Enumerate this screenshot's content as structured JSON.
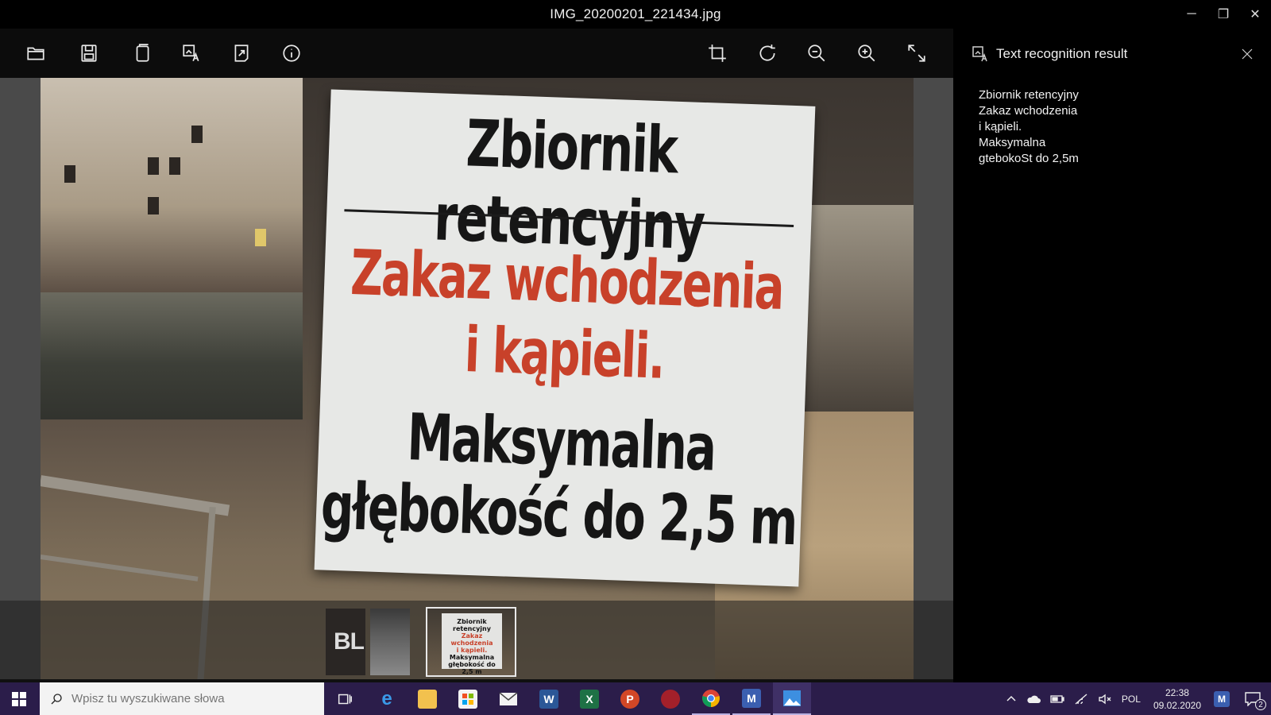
{
  "window": {
    "title": "IMG_20200201_221434.jpg",
    "controls": {
      "minimize": "─",
      "restore": "❐",
      "close": "✕"
    }
  },
  "toolbar": {
    "left_icons": [
      "folder-open-icon",
      "save-icon",
      "copy-icon",
      "text-recognition-icon",
      "export-icon",
      "info-icon"
    ],
    "right_icons": [
      "crop-icon",
      "rotate-icon",
      "zoom-out-icon",
      "zoom-in-icon",
      "fullscreen-icon"
    ]
  },
  "photo": {
    "sign": {
      "line1": "Zbiornik retencyjny",
      "line2": "Zakaz wchodzenia",
      "line3": "i kąpieli.",
      "line4": "Maksymalna",
      "line5": "głębokość do 2,5 m"
    }
  },
  "filmstrip": {
    "thumb1_text": "BL",
    "thumb3_text": [
      "Zbiornik retencyjny",
      "Zakaz wchodzenia",
      "i kąpieli.",
      "Maksymalna",
      "głębokość do 2,5 m"
    ]
  },
  "panel": {
    "title": "Text recognition result",
    "ocr_lines": [
      "Zbiornik retencyjny",
      "Zakaz wchodzenia",
      "i kąpieli.",
      "Maksymalna",
      "gtebokoSt do 2,5m"
    ]
  },
  "taskbar": {
    "search_placeholder": "Wpisz tu wyszukiwane słowa",
    "apps": [
      "task-view",
      "edge",
      "file-explorer",
      "store",
      "mail",
      "word",
      "excel",
      "powerpoint",
      "app-red",
      "chrome",
      "app-m",
      "photos"
    ],
    "language": "POL",
    "time": "22:38",
    "date": "09.02.2020",
    "notification_count": "2"
  },
  "colors": {
    "taskbar": "#2b1d4a",
    "sign_red": "#c8412a",
    "sign_bg": "#e7e8e6"
  }
}
